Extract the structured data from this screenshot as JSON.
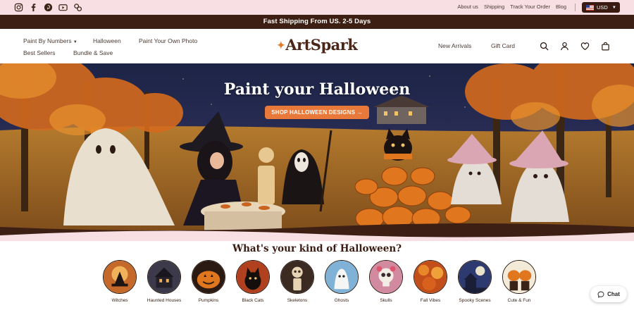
{
  "social": {
    "icons": [
      "instagram-icon",
      "facebook-icon",
      "pinterest-icon",
      "youtube-icon",
      "link-icon"
    ]
  },
  "utility_nav": {
    "links": [
      "About us",
      "Shipping",
      "Track Your Order",
      "Blog"
    ],
    "currency": "USD"
  },
  "announcement": {
    "text": "Fast Shipping From US. 2-5 Days"
  },
  "header": {
    "logo": "ArtSpark",
    "nav_left": {
      "row1": [
        "Paint By Numbers",
        "Halloween",
        "Paint Your Own Photo"
      ],
      "row2": [
        "Best Sellers",
        "Bundle & Save"
      ]
    },
    "nav_right": [
      "New Arrivals",
      "Gift Card"
    ],
    "icons": [
      "search-icon",
      "account-icon",
      "wishlist-icon",
      "cart-icon"
    ]
  },
  "hero": {
    "title": "Paint your Halloween",
    "cta": "SHOP HALLOWEEN DESIGNS →"
  },
  "categories": {
    "title": "What's your kind of Halloween?",
    "items": [
      "Witches",
      "Haunted Houses",
      "Pumpkins",
      "Black Cats",
      "Skeletons",
      "Ghosts",
      "Skulls",
      "Fall Vibes",
      "Spooky Scenes",
      "Cute & Fun"
    ]
  },
  "chat": {
    "label": "Chat"
  },
  "colors": {
    "brand_dark": "#3d1f13",
    "accent_orange": "#e8793a",
    "utility_pink": "#f7dfe3"
  }
}
